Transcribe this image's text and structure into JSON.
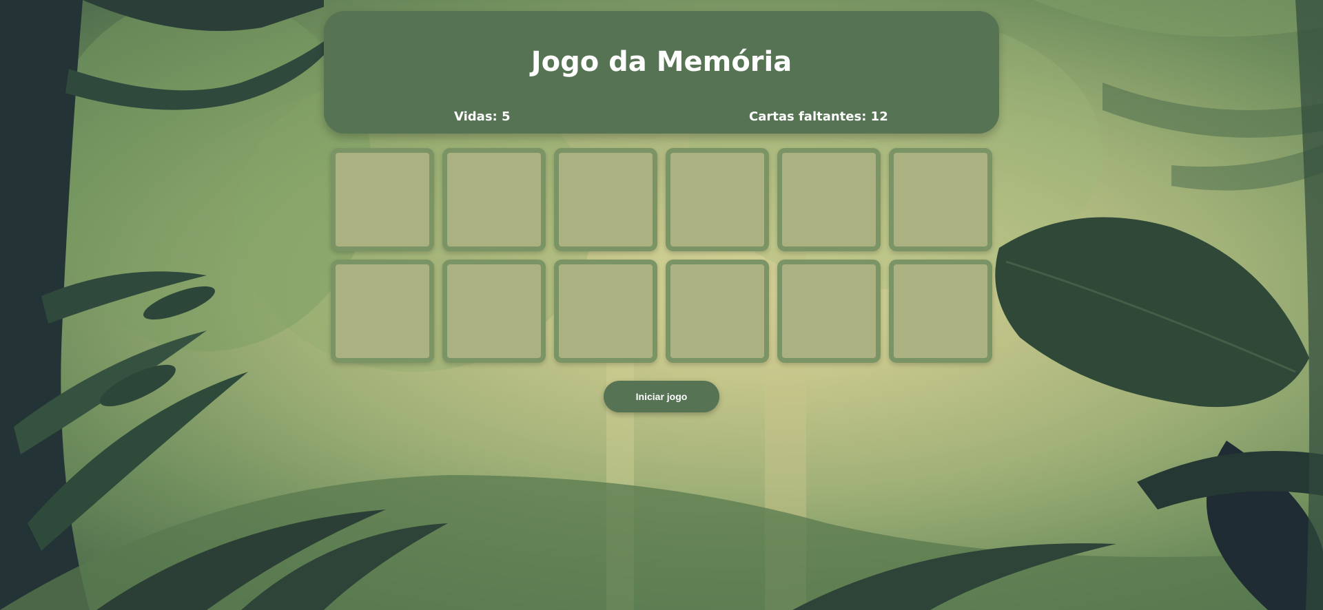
{
  "game": {
    "title": "Jogo da Memória",
    "lives_text": "Vidas: 5",
    "lives": 5,
    "remaining_text": "Cartas faltantes: 12",
    "cards_remaining": 12
  },
  "board": {
    "rows": 2,
    "columns": 6,
    "cards": [
      {
        "state": "face-down"
      },
      {
        "state": "face-down"
      },
      {
        "state": "face-down"
      },
      {
        "state": "face-down"
      },
      {
        "state": "face-down"
      },
      {
        "state": "face-down"
      },
      {
        "state": "face-down"
      },
      {
        "state": "face-down"
      },
      {
        "state": "face-down"
      },
      {
        "state": "face-down"
      },
      {
        "state": "face-down"
      },
      {
        "state": "face-down"
      }
    ]
  },
  "controls": {
    "start_label": "Iniciar jogo"
  },
  "colors": {
    "panel": "#567453",
    "card_face": "#abb180",
    "card_border": "#7b9466",
    "text": "#ffffff"
  }
}
